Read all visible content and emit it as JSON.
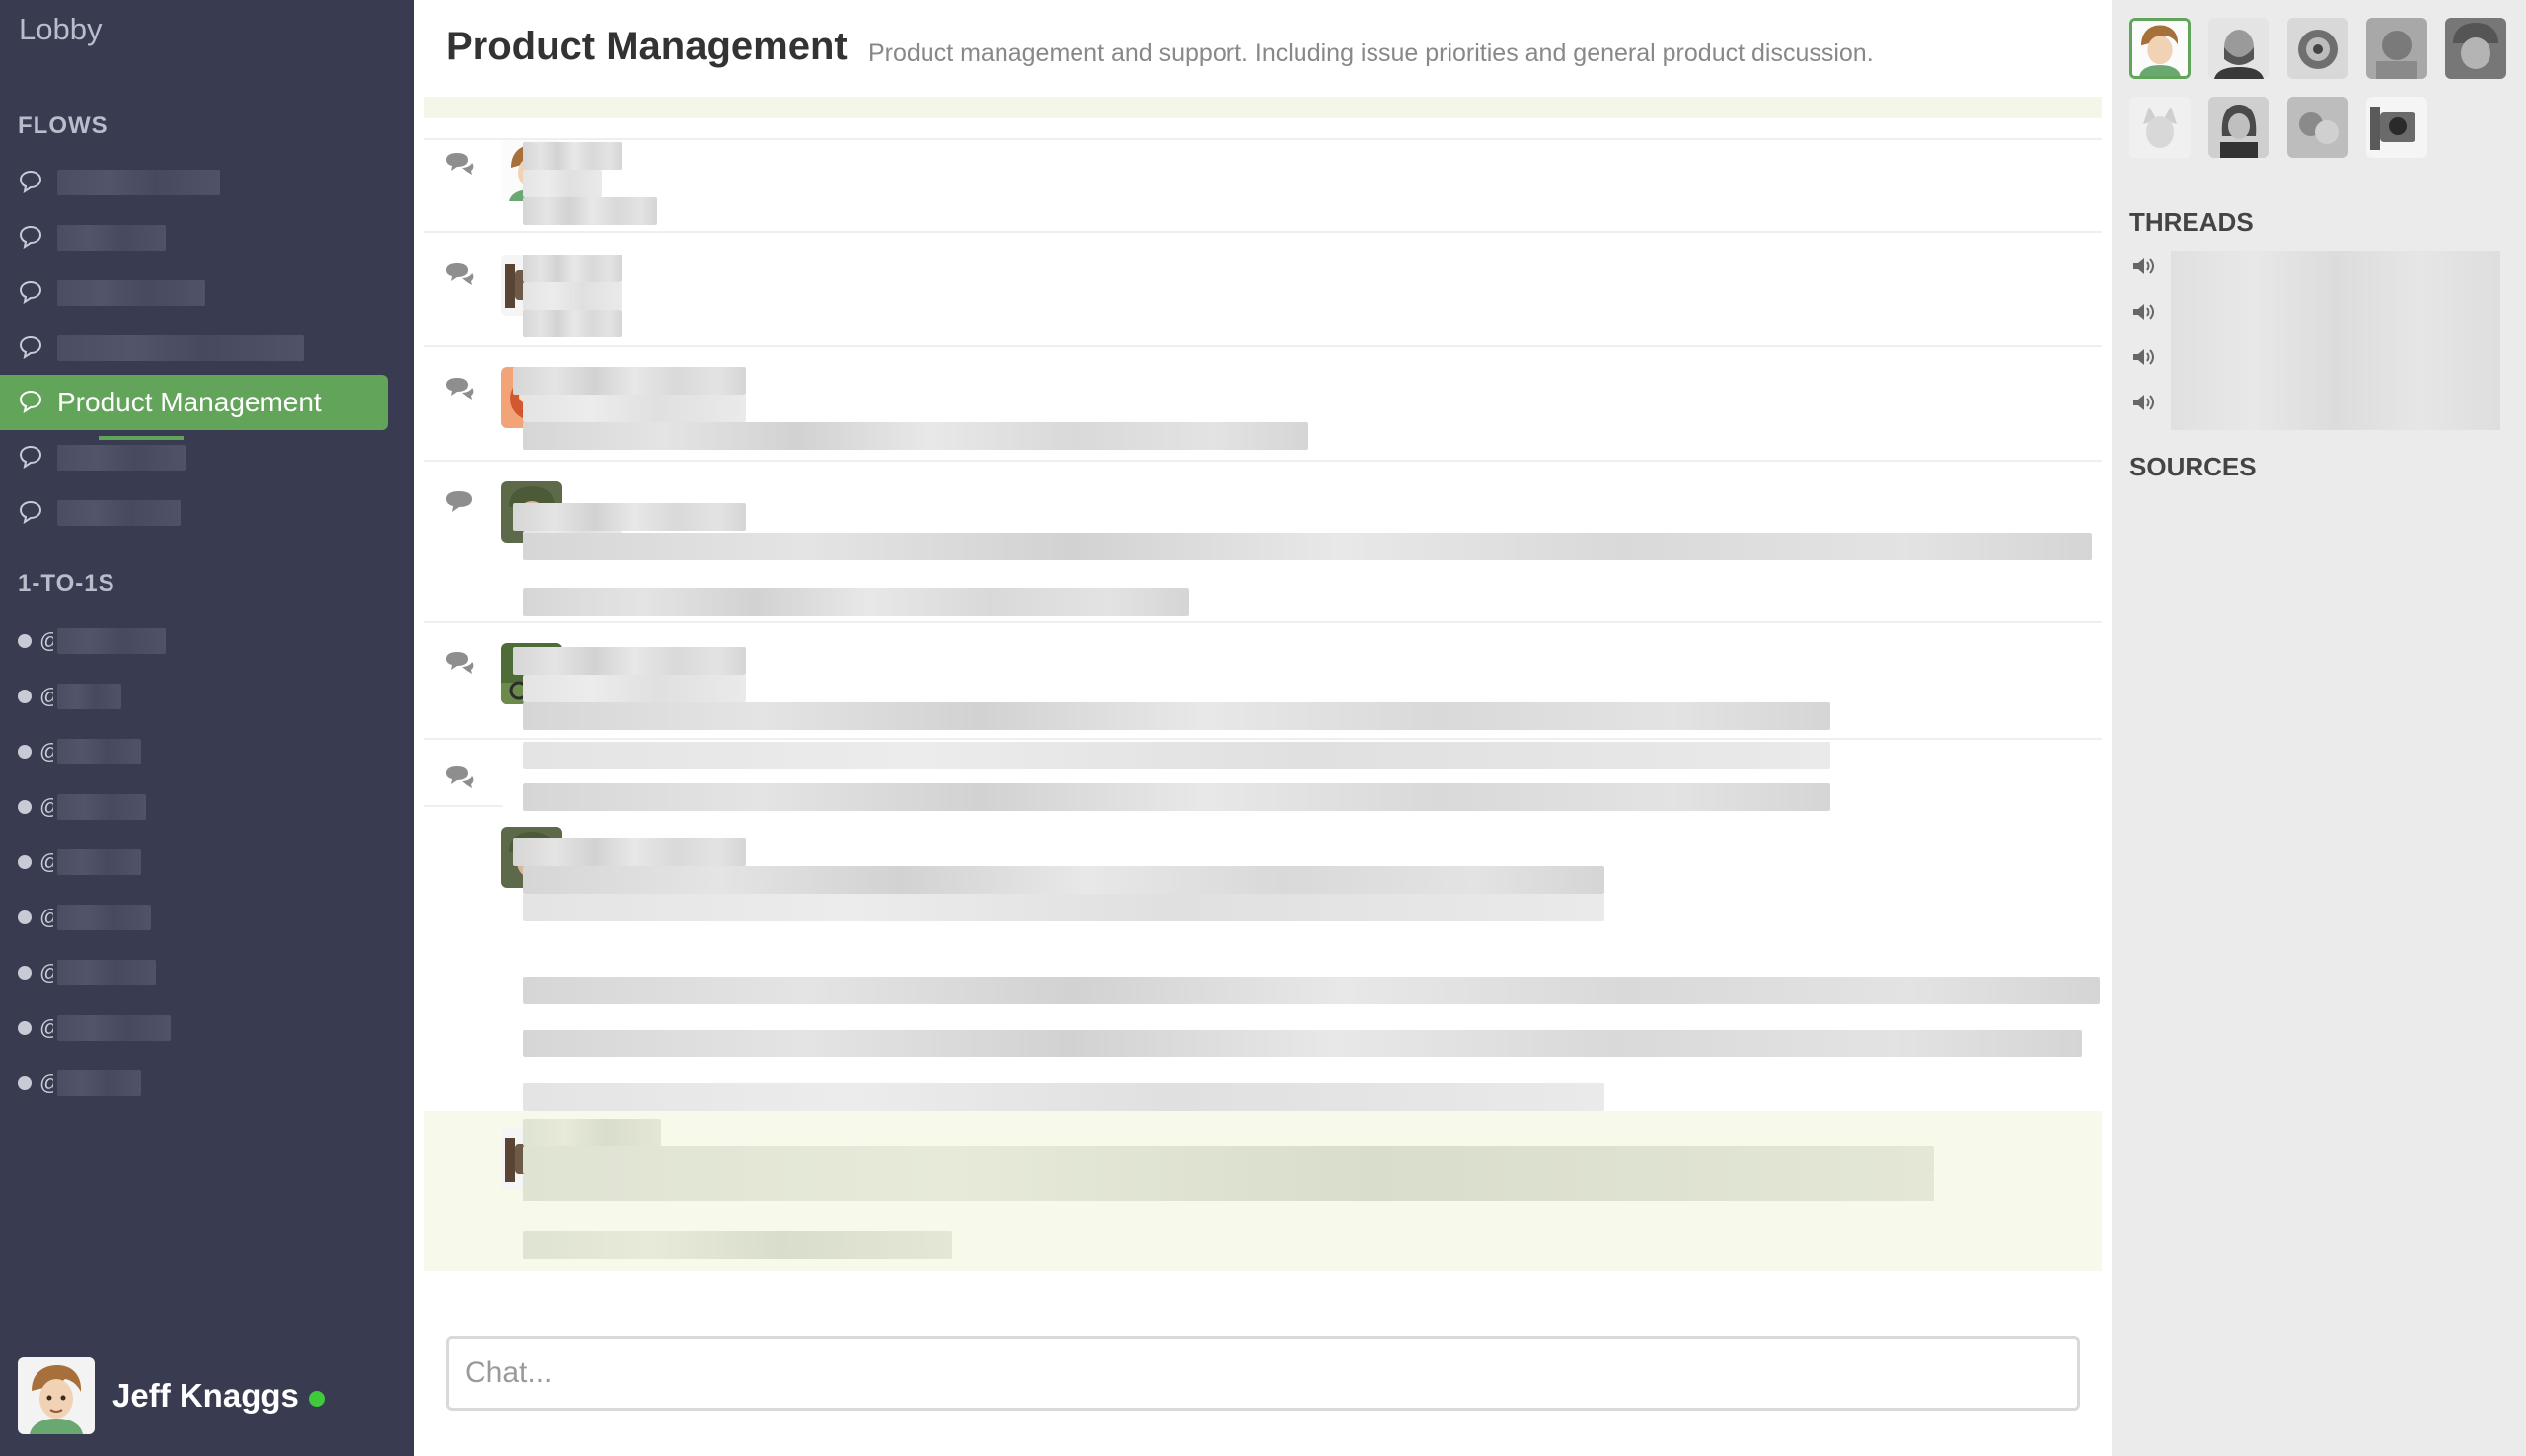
{
  "sidebar": {
    "lobby": "Lobby",
    "flows_label": "FLOWS",
    "active_flow": "Product Management",
    "dms_label": "1-TO-1S",
    "user": {
      "name": "Jeff Knaggs",
      "status": "online"
    }
  },
  "main": {
    "title": "Product Management",
    "description": "Product management and support. Including issue priorities and general product discussion.",
    "chat_placeholder": "Chat..."
  },
  "right": {
    "threads_label": "THREADS",
    "sources_label": "SOURCES"
  },
  "colors": {
    "sidebar_bg": "#393c50",
    "accent_green": "#62a55a",
    "online": "#3fc93d",
    "right_bg": "#ebebeb"
  },
  "icons": [
    "chat-bubbles-icon",
    "comment-icon",
    "speaker-icon",
    "dot-icon",
    "avatar"
  ]
}
